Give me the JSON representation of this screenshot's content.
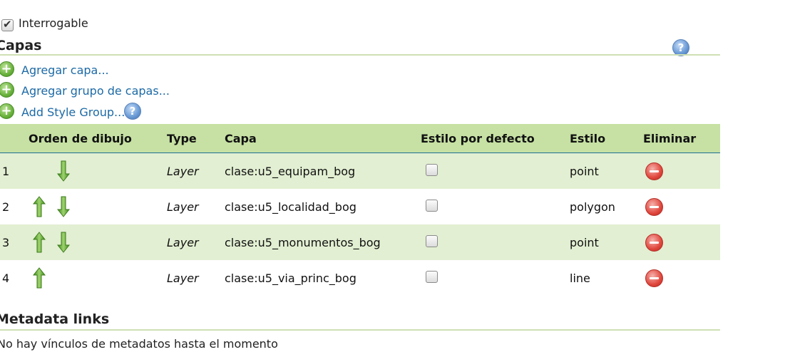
{
  "interrogable": {
    "label": "Interrogable",
    "checked": true
  },
  "capas": {
    "title": "Capas",
    "actions": [
      {
        "label": "Agregar capa..."
      },
      {
        "label": "Agregar grupo de capas..."
      },
      {
        "label": "Add Style Group..."
      }
    ]
  },
  "table": {
    "headers": {
      "order": "Orden de dibujo",
      "type": "Type",
      "layer": "Capa",
      "default_style": "Estilo por defecto",
      "style": "Estilo",
      "delete": "Eliminar"
    },
    "rows": [
      {
        "num": "1",
        "type": "Layer",
        "layer": "clase:u5_equipam_bog",
        "default_style": false,
        "style": "point",
        "up": false,
        "down": true
      },
      {
        "num": "2",
        "type": "Layer",
        "layer": "clase:u5_localidad_bog",
        "default_style": false,
        "style": "polygon",
        "up": true,
        "down": true
      },
      {
        "num": "3",
        "type": "Layer",
        "layer": "clase:u5_monumentos_bog",
        "default_style": false,
        "style": "point",
        "up": true,
        "down": true
      },
      {
        "num": "4",
        "type": "Layer",
        "layer": "clase:u5_via_princ_bog",
        "default_style": false,
        "style": "line",
        "up": true,
        "down": false
      }
    ]
  },
  "metadata": {
    "title": "Metadata links",
    "empty_text": "No hay vínculos de metadatos hasta el momento"
  },
  "colors": {
    "header_bg": "#c6e1a3",
    "row_shade": "#e2efd2",
    "link": "#1c6aa6",
    "rule": "#cfe0b4"
  },
  "icons": {
    "add": "add-circle-icon",
    "help": "help-icon",
    "up": "arrow-up-icon",
    "down": "arrow-down-icon",
    "delete": "delete-icon"
  }
}
